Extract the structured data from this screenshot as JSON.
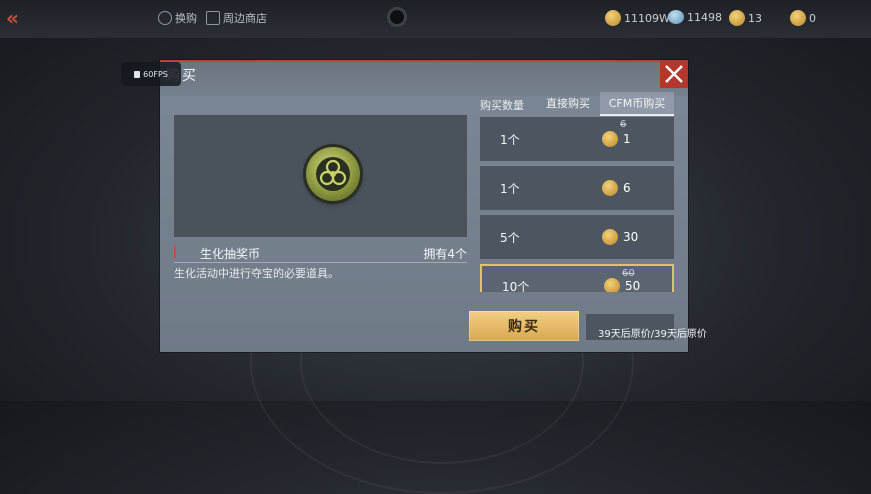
{
  "topbar": {
    "exchange_label": "换购",
    "shop_label": "周边商店",
    "currencies": [
      {
        "icon": "gold-coin-icon",
        "value": "11109W"
      },
      {
        "icon": "diamond-icon",
        "value": "11498"
      },
      {
        "icon": "cfm-coin-icon",
        "value": "13"
      },
      {
        "icon": "cfm-coin-icon",
        "value": "0"
      }
    ]
  },
  "fps": {
    "label": "60FPS"
  },
  "dialog": {
    "title": "购买",
    "item": {
      "name": "生化抽奖币",
      "owned": "拥有4个",
      "description": "生化活动中进行夺宝的必要道具。",
      "icon": "biohazard-coin-icon"
    },
    "quantity_label": "购买数量",
    "tabs": [
      {
        "label": "直接购买",
        "active": false
      },
      {
        "label": "CFM币购买",
        "active": true
      }
    ],
    "options": [
      {
        "qty": "1个",
        "old_price": "6",
        "price": "1",
        "selected": false
      },
      {
        "qty": "1个",
        "old_price": "",
        "price": "6",
        "selected": false
      },
      {
        "qty": "5个",
        "old_price": "",
        "price": "30",
        "selected": false
      },
      {
        "qty": "10个",
        "old_price": "60",
        "price": "50",
        "selected": true
      }
    ],
    "buy_label": "购买",
    "price_note": "39天后原价/39天后原价"
  },
  "colors": {
    "accent_red": "#c2403a",
    "gold": "#e2c071"
  }
}
